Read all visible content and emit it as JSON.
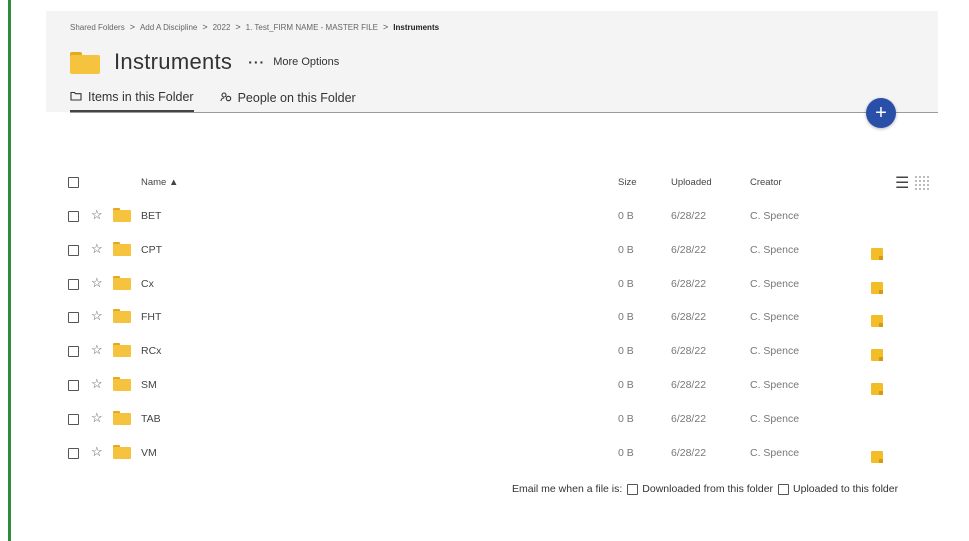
{
  "breadcrumb": {
    "items": [
      "Shared Folders",
      "Add A Discipline",
      "2022",
      "1. Test_FIRM NAME - MASTER FILE"
    ],
    "current": "Instruments",
    "separator": ">"
  },
  "folder": {
    "title": "Instruments",
    "more_options_dots": "···",
    "more_options_label": "More Options"
  },
  "tabs": [
    {
      "label": "Items in this Folder",
      "icon": "folder-outline-icon"
    },
    {
      "label": "People on this Folder",
      "icon": "people-icon"
    }
  ],
  "fab": {
    "label": "+"
  },
  "columns": {
    "name": "Name ▲",
    "size": "Size",
    "uploaded": "Uploaded",
    "creator": "Creator"
  },
  "rows": [
    {
      "name": "BET",
      "size": "0 B",
      "uploaded": "6/28/22",
      "creator": "C. Spence",
      "note": false
    },
    {
      "name": "CPT",
      "size": "0 B",
      "uploaded": "6/28/22",
      "creator": "C. Spence",
      "note": true
    },
    {
      "name": "Cx",
      "size": "0 B",
      "uploaded": "6/28/22",
      "creator": "C. Spence",
      "note": true
    },
    {
      "name": "FHT",
      "size": "0 B",
      "uploaded": "6/28/22",
      "creator": "C. Spence",
      "note": true
    },
    {
      "name": "RCx",
      "size": "0 B",
      "uploaded": "6/28/22",
      "creator": "C. Spence",
      "note": true
    },
    {
      "name": "SM",
      "size": "0 B",
      "uploaded": "6/28/22",
      "creator": "C. Spence",
      "note": true
    },
    {
      "name": "TAB",
      "size": "0 B",
      "uploaded": "6/28/22",
      "creator": "C. Spence",
      "note": false
    },
    {
      "name": "VM",
      "size": "0 B",
      "uploaded": "6/28/22",
      "creator": "C. Spence",
      "note": true
    }
  ],
  "email": {
    "prefix": "Email me when a file is:",
    "option1": "Downloaded from this folder",
    "option2": "Uploaded to this folder"
  },
  "colors": {
    "accent_green": "#2e8b3a",
    "fab_blue": "#2a4fa8",
    "folder_yellow": "#f5c33d",
    "note_yellow": "#f2bd26"
  }
}
